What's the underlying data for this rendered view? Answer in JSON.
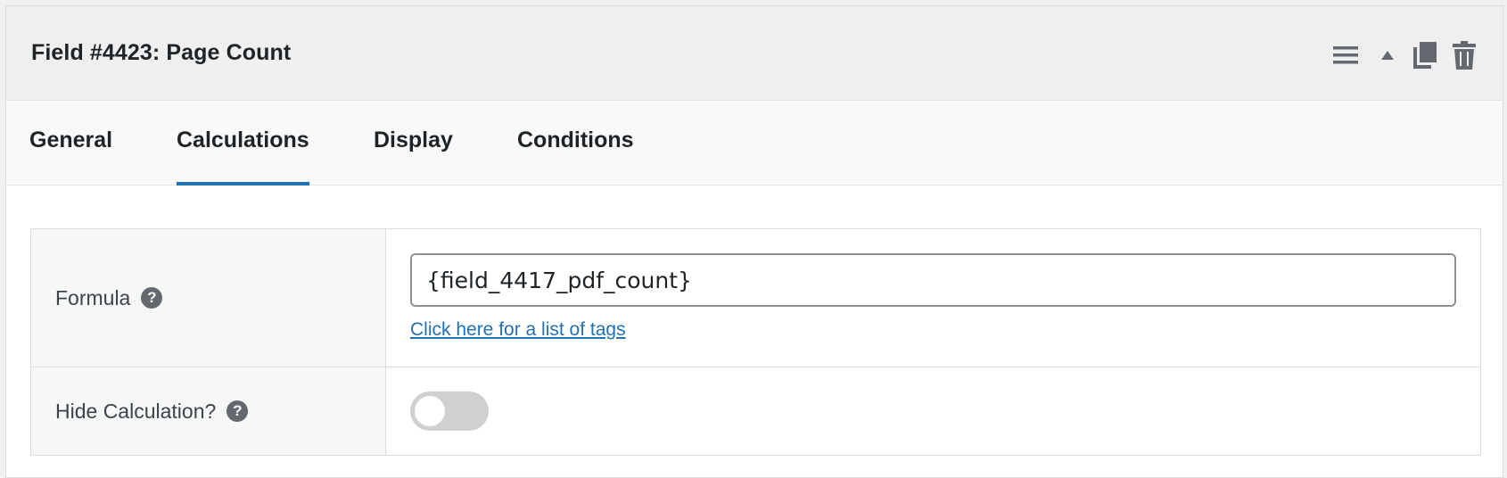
{
  "header": {
    "title": "Field #4423: Page Count",
    "icons": [
      "menu-icon",
      "collapse-arrow-icon",
      "duplicate-icon",
      "trash-icon"
    ]
  },
  "tabs": [
    {
      "label": "General",
      "active": false
    },
    {
      "label": "Calculations",
      "active": true
    },
    {
      "label": "Display",
      "active": false
    },
    {
      "label": "Conditions",
      "active": false
    }
  ],
  "settings": {
    "formula": {
      "label": "Formula",
      "value": "{field_4417_pdf_count}",
      "link_text": "Click here for a list of tags"
    },
    "hide_calculation": {
      "label": "Hide Calculation?",
      "enabled": false
    }
  },
  "colors": {
    "accent": "#2271b1",
    "header_bg": "#efefef",
    "icon": "#646970"
  }
}
